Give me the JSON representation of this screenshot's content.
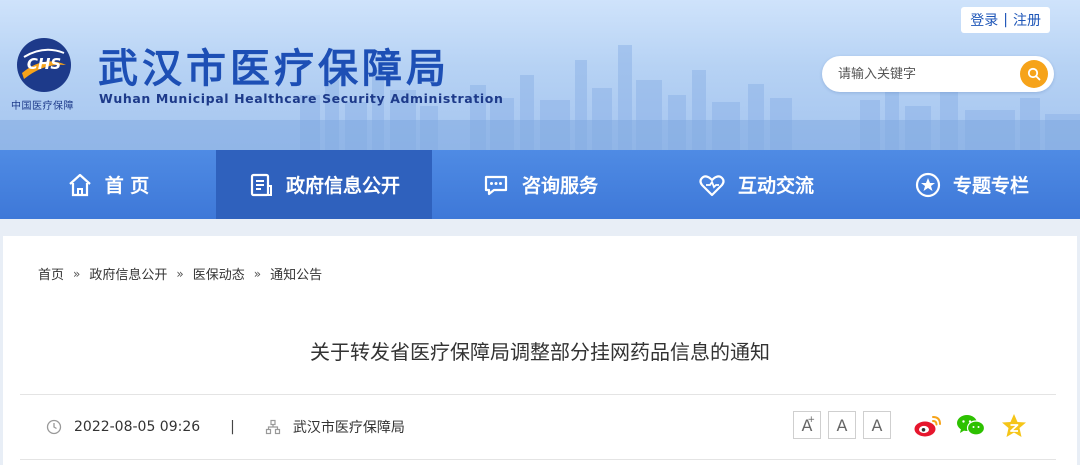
{
  "header": {
    "auth": {
      "login": "登录",
      "separator": "|",
      "register": "注册"
    },
    "logo": {
      "mark_text": "CHS",
      "subtitle": "中国医疗保障"
    },
    "title_cn": "武汉市医疗保障局",
    "title_en": "Wuhan Municipal Healthcare Security Administration",
    "search": {
      "placeholder": "请输入关键字",
      "button_icon": "search-icon"
    }
  },
  "nav": {
    "items": [
      {
        "label": "首 页",
        "icon": "home-icon",
        "active": false
      },
      {
        "label": "政府信息公开",
        "icon": "document-icon",
        "active": true
      },
      {
        "label": "咨询服务",
        "icon": "chat-icon",
        "active": false
      },
      {
        "label": "互动交流",
        "icon": "heart-icon",
        "active": false
      },
      {
        "label": "专题专栏",
        "icon": "star-icon",
        "active": false
      }
    ]
  },
  "breadcrumb": {
    "items": [
      "首页",
      "政府信息公开",
      "医保动态",
      "通知公告"
    ],
    "separator": "»"
  },
  "article": {
    "title": "关于转发省医疗保障局调整部分挂网药品信息的通知",
    "date": "2022-08-05 09:26",
    "divider": "|",
    "source": "武汉市医疗保障局"
  },
  "font_size": {
    "large": "A",
    "large_mark": "+",
    "medium": "A",
    "small": "A"
  },
  "share": [
    "weibo-icon",
    "wechat-icon",
    "qzone-icon"
  ],
  "colors": {
    "brand_blue": "#1d4fb5",
    "nav_blue": "#3e78d8",
    "nav_active": "#2f61bd",
    "search_orange": "#f6a31a"
  }
}
